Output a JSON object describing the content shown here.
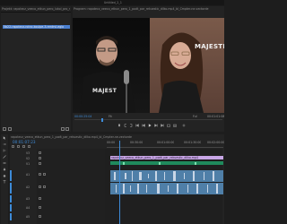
{
  "window": {
    "title": "Untitled_2_1"
  },
  "source_panel": {
    "tab_label": "Projekt: rapotecz_veeco_etkun_pero_lukol_pro_ritkuestic_dilko",
    "selected_item": "5b22-rapotecz-rotnc-koulpe-3-rentrvl-eglo",
    "left_header": "Projekt: rapotecz_veeco_etkun_pero_lukol_pro_ritkuestic_dilko"
  },
  "program_monitor": {
    "tab_label": "Program: rapotecz_veeco_etkun_pero_1_podt_par_rekuestic_dilko.mp4_bl_Cmpter-ne-vectorde",
    "timecode_left": "00:00:25:04",
    "fit_label": "Fit",
    "quality_label": "Full",
    "timecode_right": "00:01:01:08",
    "video_text_left": "MAJEST",
    "video_text_right": "MAJESTI"
  },
  "timeline": {
    "tab_label": "rapotecz_veeco_etkun_pero_1_podt_par_rekuestic_dilko.mp4_bl_Cmpter-ne-vectorde",
    "timecode": "00:01:07:23",
    "ruler_labels": [
      "00:00",
      "00:30:00",
      "00:01:00:00",
      "00:01:30:00",
      "00:02:00:00"
    ],
    "video_tracks": [
      "V3",
      "V2",
      "V1"
    ],
    "audio_tracks": [
      "A1",
      "A2",
      "A3",
      "A4",
      "A5"
    ],
    "clip_label": "rapotecz_veeco_etkun_pero_1_podt_par_rekuestic_dilko.mp4"
  },
  "colors": {
    "accent_blue": "#3d8bd8",
    "clip_green": "#1f8a5c",
    "clip_purple": "#b58bd6",
    "audio_clip": "#5b8bb5",
    "playhead": "#3d8bd8"
  }
}
